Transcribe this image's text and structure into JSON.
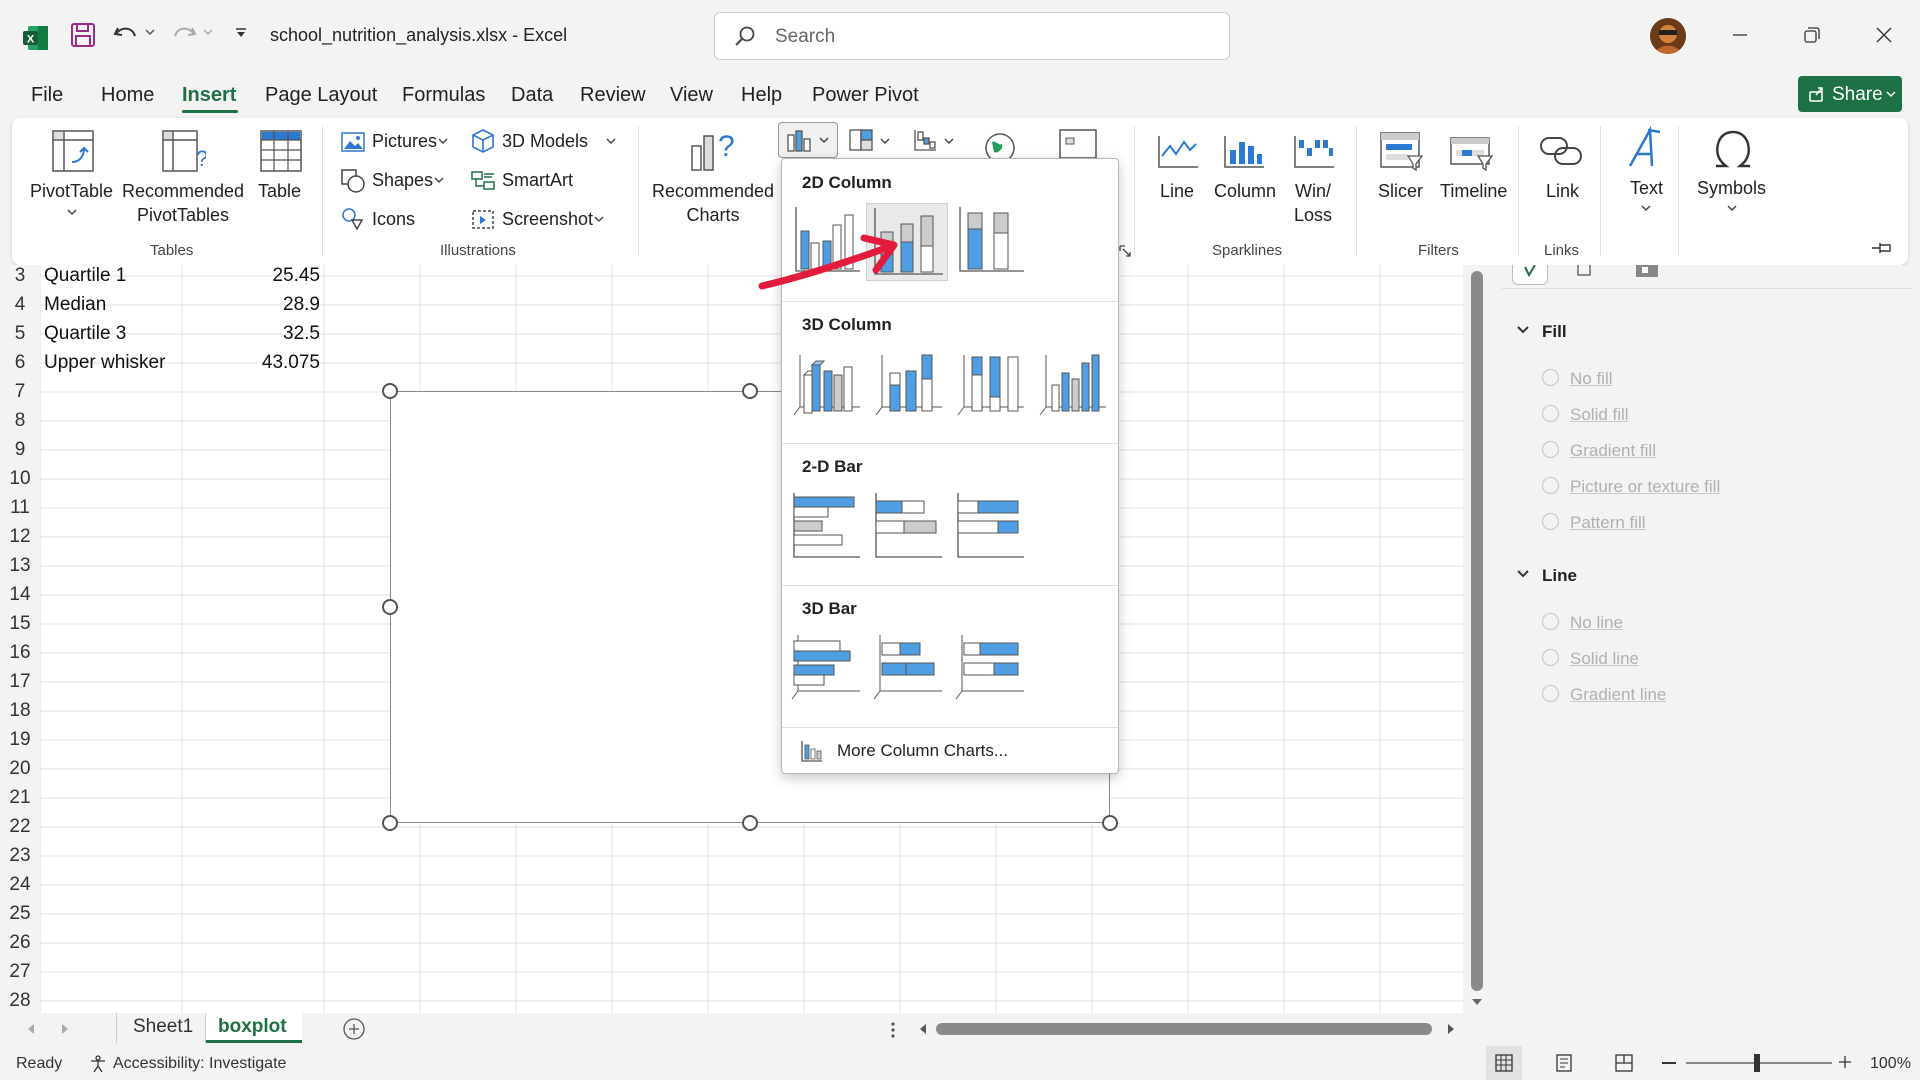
{
  "titlebar": {
    "filename": "school_nutrition_analysis.xlsx",
    "separator": "-",
    "app_name": "Excel",
    "search_placeholder": "Search"
  },
  "menu": {
    "tabs": [
      "File",
      "Home",
      "Insert",
      "Page Layout",
      "Formulas",
      "Data",
      "Review",
      "View",
      "Help",
      "Power Pivot"
    ],
    "active_tab": "Insert",
    "share_label": "Share"
  },
  "ribbon": {
    "tables": {
      "pivottable": "PivotTable",
      "recommended_1": "Recommended",
      "recommended_2": "PivotTables",
      "table": "Table",
      "group": "Tables"
    },
    "illustrations": {
      "pictures": "Pictures",
      "shapes": "Shapes",
      "icons": "Icons",
      "models": "3D Models",
      "smartart": "SmartArt",
      "screenshot": "Screenshot",
      "group": "Illustrations"
    },
    "charts": {
      "recommended_1": "Recommended",
      "recommended_2": "Charts"
    },
    "sparklines": {
      "line": "Line",
      "column": "Column",
      "winloss_1": "Win/",
      "winloss_2": "Loss",
      "group": "Sparklines"
    },
    "filters": {
      "slicer": "Slicer",
      "timeline": "Timeline",
      "group": "Filters"
    },
    "links": {
      "link": "Link",
      "group": "Links"
    },
    "text": {
      "label": "Text"
    },
    "symbols": {
      "label": "Symbols"
    }
  },
  "sheet": {
    "rows": [
      {
        "n": "3",
        "label": "Quartile 1",
        "value": "25.45"
      },
      {
        "n": "4",
        "label": "Median",
        "value": "28.9"
      },
      {
        "n": "5",
        "label": "Quartile 3",
        "value": "32.5"
      },
      {
        "n": "6",
        "label": "Upper whisker",
        "value": "43.075"
      }
    ],
    "empty_rows": [
      "7",
      "8",
      "9",
      "10",
      "11",
      "12",
      "13",
      "14",
      "15",
      "16",
      "17",
      "18",
      "19",
      "20",
      "21",
      "22",
      "23",
      "24",
      "25",
      "26",
      "27",
      "28"
    ]
  },
  "dropdown": {
    "section_2d_column": "2D Column",
    "section_3d_column": "3D Column",
    "section_2d_bar": "2-D Bar",
    "section_3d_bar": "3D Bar",
    "more": "More Column Charts..."
  },
  "format_panel": {
    "fill_title": "Fill",
    "fill_options": [
      "No fill",
      "Solid fill",
      "Gradient fill",
      "Picture or texture fill",
      "Pattern fill"
    ],
    "line_title": "Line",
    "line_options": [
      "No line",
      "Solid line",
      "Gradient line"
    ]
  },
  "sheet_tabs": {
    "tabs": [
      "Sheet1",
      "boxplot"
    ],
    "active": "boxplot"
  },
  "status": {
    "ready": "Ready",
    "accessibility": "Accessibility: Investigate",
    "zoom": "100%"
  },
  "colors": {
    "excel_green": "#1e7145",
    "accent_blue": "#4f9ee3",
    "arrow_red": "#e31b3c"
  }
}
